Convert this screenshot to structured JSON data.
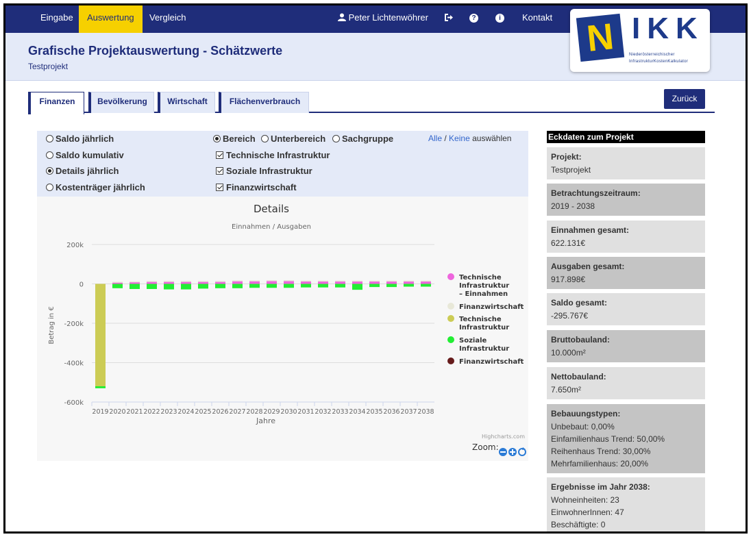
{
  "nav": {
    "items": [
      "Eingabe",
      "Auswertung",
      "Vergleich"
    ],
    "user": "Peter Lichtenwöhrer",
    "contact": "Kontakt"
  },
  "header": {
    "title": "Grafische Projektauswertung - Schätzwerte",
    "subtitle": "Testprojekt"
  },
  "logo": {
    "big_letter": "N",
    "letters": "IKK",
    "line1": "Niederösterreichischer",
    "line2": "InfrastrukturKostenKalkulator"
  },
  "tabs": [
    "Finanzen",
    "Bevölkerung",
    "Wirtschaft",
    "Flächenverbrauch"
  ],
  "back_label": "Zurück",
  "controls": {
    "view_options": [
      "Saldo jährlich",
      "Saldo kumulativ",
      "Details jährlich",
      "Kostenträger jährlich"
    ],
    "selected_view": "Details jährlich",
    "grouping": [
      "Bereich",
      "Unterbereich",
      "Sachgruppe"
    ],
    "selected_grouping": "Bereich",
    "categories": [
      "Technische Infrastruktur",
      "Soziale Infrastruktur",
      "Finanzwirtschaft"
    ],
    "select_all": "Alle",
    "separator": "/",
    "select_none": "Keine",
    "select_suffix": "auswählen"
  },
  "chart_data": {
    "type": "bar",
    "title": "Details",
    "subtitle": "Einnahmen / Ausgaben",
    "xlabel": "Jahre",
    "ylabel": "Betrag in €",
    "ylim": [
      -600000,
      200000
    ],
    "yticks": [
      "200k",
      "0",
      "-200k",
      "-400k",
      "-600k"
    ],
    "categories": [
      "2019",
      "2020",
      "2021",
      "2022",
      "2023",
      "2024",
      "2025",
      "2026",
      "2027",
      "2028",
      "2029",
      "2030",
      "2031",
      "2032",
      "2033",
      "2034",
      "2035",
      "2036",
      "2037",
      "2038"
    ],
    "series": [
      {
        "name": "Technische Infrastruktur – Einnahmen",
        "color": "#ee66dd",
        "values": [
          0,
          8000,
          10000,
          12000,
          12000,
          12000,
          12000,
          12000,
          15000,
          15000,
          16000,
          16000,
          14000,
          14000,
          14000,
          14000,
          14000,
          14000,
          14000,
          14000
        ]
      },
      {
        "name": "Finanzwirtschaft",
        "color": "#e8e8d8",
        "values": [
          0,
          3000,
          3000,
          3000,
          3000,
          3000,
          3000,
          3000,
          3000,
          3000,
          3000,
          3000,
          3000,
          3000,
          3000,
          3000,
          3000,
          3000,
          3000,
          3000
        ]
      },
      {
        "name": "Technische Infrastruktur",
        "color": "#cccc55",
        "values": [
          -520000,
          0,
          0,
          0,
          0,
          0,
          0,
          0,
          0,
          0,
          0,
          0,
          0,
          0,
          0,
          0,
          0,
          0,
          0,
          0
        ]
      },
      {
        "name": "Soziale Infrastruktur",
        "color": "#22ee33",
        "values": [
          -10000,
          -22000,
          -26000,
          -26000,
          -28000,
          -28000,
          -24000,
          -22000,
          -22000,
          -20000,
          -20000,
          -20000,
          -18000,
          -18000,
          -18000,
          -30000,
          -16000,
          -16000,
          -14000,
          -14000
        ]
      },
      {
        "name": "Finanzwirtschaft",
        "color": "#661b1b",
        "values": [
          0,
          0,
          0,
          0,
          0,
          0,
          0,
          0,
          0,
          0,
          0,
          0,
          0,
          0,
          0,
          0,
          0,
          0,
          0,
          0
        ]
      }
    ],
    "legend_position": "right",
    "grid": true,
    "credits": "Highcharts.com",
    "zoom_label": "Zoom:"
  },
  "panel": {
    "title": "Eckdaten zum Projekt",
    "cards": [
      {
        "label": "Projekt:",
        "values": [
          "Testprojekt"
        ]
      },
      {
        "label": "Betrachtungszeitraum:",
        "values": [
          "2019 - 2038"
        ]
      },
      {
        "label": "Einnahmen gesamt:",
        "values": [
          "622.131€"
        ]
      },
      {
        "label": "Ausgaben gesamt:",
        "values": [
          "917.898€"
        ]
      },
      {
        "label": "Saldo gesamt:",
        "values": [
          "-295.767€"
        ]
      },
      {
        "label": "Bruttobauland:",
        "values": [
          "10.000m²"
        ]
      },
      {
        "label": "Nettobauland:",
        "values": [
          "7.650m²"
        ]
      },
      {
        "label": "Bebauungstypen:",
        "values": [
          "Unbebaut: 0,00%",
          "Einfamilienhaus Trend: 50,00%",
          "Reihenhaus Trend: 30,00%",
          "Mehrfamilienhaus: 20,00%"
        ]
      },
      {
        "label": "Ergebnisse im Jahr 2038:",
        "values": [
          "Wohneinheiten: 23",
          "EinwohnerInnen: 47",
          "Beschäftigte: 0"
        ]
      }
    ]
  },
  "colors": {
    "nav_bg": "#1f2d7a",
    "active_tab": "#f6d000",
    "header_bg": "#e4eaf8"
  }
}
